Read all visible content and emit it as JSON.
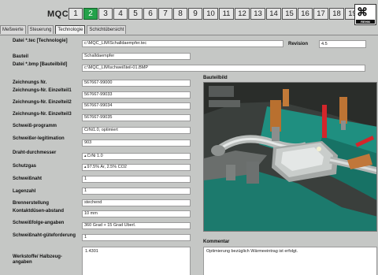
{
  "header": {
    "app_label": "MQC",
    "number_tabs": [
      "1",
      "2",
      "3",
      "4",
      "5",
      "6",
      "7",
      "8",
      "9",
      "10",
      "11",
      "12",
      "13",
      "14",
      "15",
      "16",
      "17",
      "18",
      "19",
      "20"
    ],
    "active_tab": "2",
    "logo_caption": "REHM"
  },
  "subtabs": [
    "Meßwerte",
    "Steuerung",
    "Technologie",
    "Schichtübersicht"
  ],
  "active_subtab": "Technologie",
  "fields": {
    "datei_tec_label": "Datei *.tec [Technologie]",
    "datei_tec_value": "c:\\MQC_LIM\\Schalldaempfer.tec",
    "revision_label": "Revision",
    "revision_value": "4.5",
    "bauteil_label": "Bauteil",
    "bauteil_value": "Schalldaempfer",
    "datei_bmp_label": "Datei *.bmp [Bauteilbild]",
    "datei_bmp_value": "c:\\MQC_LIM\\schweißteil-01.BMP",
    "zeichnungs_nr_label": "Zeichnungs Nr.",
    "zeichnungs_nr_value": "567667-99000",
    "ez1_label": "Zeichnungs-Nr. Einzelteil1",
    "ez1_value": "567667-99033",
    "ez2_label": "Zeichnungs-Nr. Einzelteil2",
    "ez2_value": "567667-99034",
    "ez3_label": "Zeichnungs-Nr. Einzelteil3",
    "ez3_value": "567667-99035",
    "schweissprogramm_label": "Schweiß-programm",
    "schweissprogramm_value": "CrNi1.0, optimiert",
    "legitimation_label": "Schweißer-legitimation",
    "legitimation_value": "903",
    "draht_label": "Draht-durchmesser",
    "draht_value": "CrNi 1.0",
    "schutzgas_label": "Schutzgas",
    "schutzgas_value": "97.5% Ar, 2.5% CO2",
    "schweissnaht_label": "Schweißnaht",
    "schweissnaht_value": "1",
    "lagenzahl_label": "Lagenzahl",
    "lagenzahl_value": "1",
    "brenner_label": "Brennerstellung",
    "brenner_value": "stechend",
    "kontakt_label": "Kontaktdüsen-abstand",
    "kontakt_value": "10 mm",
    "folge_label": "Schweißfolge-angaben",
    "folge_value": "360 Grad + 15 Grad Überl.",
    "guete_label": "Schweißnaht-güteforderung",
    "guete_value": "1",
    "werkstoff_label": "Werkstoffe/ Halbzeug-angaben",
    "werkstoff_value": "1.4301"
  },
  "bauteilbild_title": "Bauteilbild",
  "kommentar_title": "Kommentar",
  "kommentar_value": "Optimierung bezüglich Wärmeeintrag ist erfolgt.",
  "colors": {
    "active_tab": "#24a24a",
    "panel_bg": "#c5c7c5",
    "field_bg": "#ffffff",
    "machine_green": "#1f8f80"
  }
}
